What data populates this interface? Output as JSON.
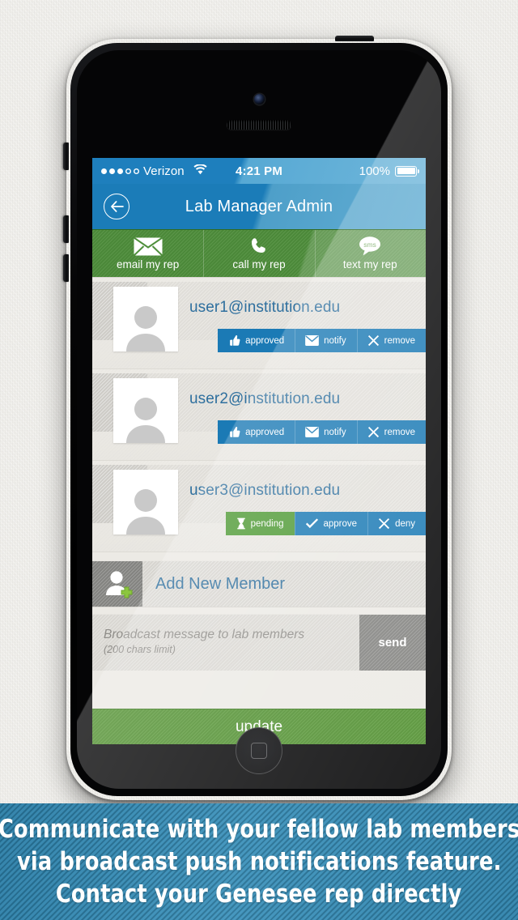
{
  "status_bar": {
    "carrier": "Verizon",
    "signal_filled": 3,
    "signal_total": 5,
    "wifi_icon": "wifi-icon",
    "time": "4:21 PM",
    "battery_percent": "100%"
  },
  "nav": {
    "back_icon": "back-arrow-icon",
    "title": "Lab Manager Admin"
  },
  "rep_bar": {
    "items": [
      {
        "icon": "envelope-icon",
        "label": "email my rep"
      },
      {
        "icon": "phone-icon",
        "label": "call my rep"
      },
      {
        "icon": "sms-bubble-icon",
        "icon_text": "sms",
        "label": "text my rep"
      }
    ]
  },
  "members": [
    {
      "email": "user1@institution.edu",
      "avatar": "person-placeholder-icon",
      "actions": [
        {
          "icon": "thumbs-up-icon",
          "label": "approved",
          "color": "blue"
        },
        {
          "icon": "envelope-icon",
          "label": "notify",
          "color": "blue"
        },
        {
          "icon": "x-icon",
          "label": "remove",
          "color": "blue"
        }
      ]
    },
    {
      "email": "user2@institution.edu",
      "avatar": "person-placeholder-icon",
      "actions": [
        {
          "icon": "thumbs-up-icon",
          "label": "approved",
          "color": "blue"
        },
        {
          "icon": "envelope-icon",
          "label": "notify",
          "color": "blue"
        },
        {
          "icon": "x-icon",
          "label": "remove",
          "color": "blue"
        }
      ]
    },
    {
      "email": "user3@institution.edu",
      "avatar": "person-placeholder-icon",
      "actions": [
        {
          "icon": "hourglass-icon",
          "label": "pending",
          "color": "green"
        },
        {
          "icon": "check-icon",
          "label": "approve",
          "color": "blue"
        },
        {
          "icon": "x-icon",
          "label": "deny",
          "color": "blue"
        }
      ]
    }
  ],
  "add_member": {
    "icon": "add-person-icon",
    "label": "Add New Member"
  },
  "broadcast": {
    "placeholder": "Broadcast message to lab members",
    "hint": "(200 chars limit)",
    "send_label": "send"
  },
  "update_label": "update",
  "caption": {
    "lines": [
      "Communicate with your fellow lab members",
      "via broadcast push notifications feature.",
      "Contact your Genesee rep directly"
    ]
  },
  "colors": {
    "blue_accent": "#1b7ab5",
    "green_accent": "#4f9a35",
    "nav_blue": "#1b7cb8",
    "caption_blue": "#3d92bb",
    "link_blue": "#2e6f9e"
  }
}
